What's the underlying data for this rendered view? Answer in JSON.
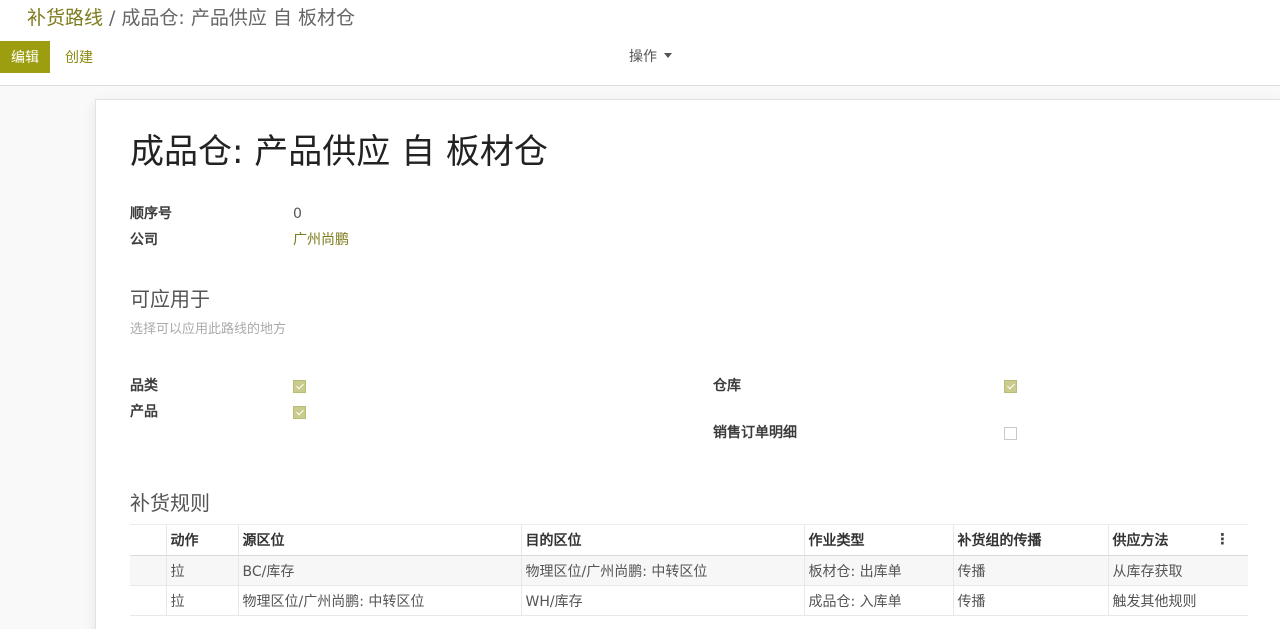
{
  "breadcrumb": {
    "parent": "补货路线",
    "separator": "/",
    "current": "成品仓: 产品供应 自 板材仓"
  },
  "toolbar": {
    "edit_label": "编辑",
    "create_label": "创建",
    "action_label": "操作"
  },
  "record": {
    "title": "成品仓: 产品供应 自 板材仓",
    "sequence": {
      "label": "顺序号",
      "value": "0"
    },
    "company": {
      "label": "公司",
      "value": "广州尚鹏"
    }
  },
  "applicable": {
    "title": "可应用于",
    "hint": "选择可以应用此路线的地方",
    "product_category": {
      "label": "品类",
      "checked": true
    },
    "product": {
      "label": "产品",
      "checked": true
    },
    "warehouse": {
      "label": "仓库",
      "checked": true
    },
    "sale_order_line": {
      "label": "销售订单明细",
      "checked": false
    }
  },
  "rules": {
    "title": "补货规则",
    "headers": [
      "动作",
      "源区位",
      "目的区位",
      "作业类型",
      "补货组的传播",
      "供应方法"
    ],
    "rows": [
      [
        "拉",
        "BC/库存",
        "物理区位/广州尚鹏: 中转区位",
        "板材仓: 出库单",
        "传播",
        "从库存获取"
      ],
      [
        "拉",
        "物理区位/广州尚鹏: 中转区位",
        "WH/库存",
        "成品仓: 入库单",
        "传播",
        "触发其他规则"
      ]
    ]
  }
}
